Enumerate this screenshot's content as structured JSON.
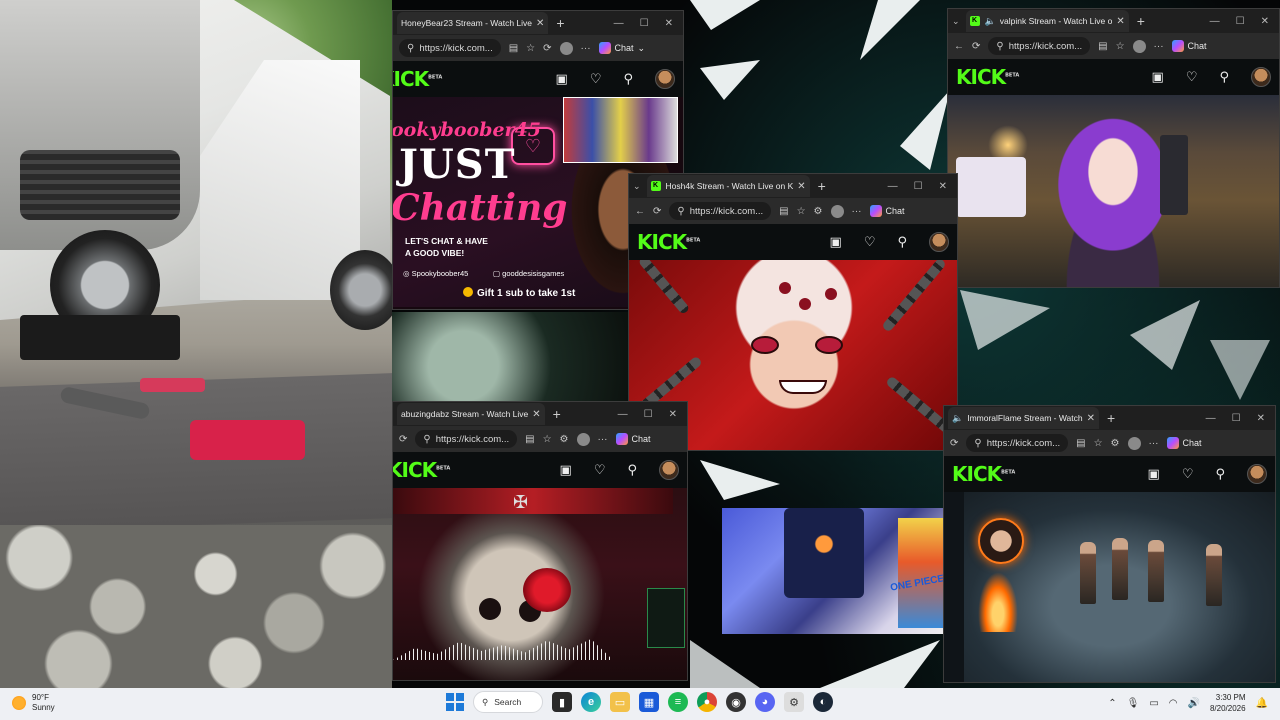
{
  "taskbar": {
    "weather_temp": "90°F",
    "weather_cond": "Sunny",
    "search_label": "Search",
    "time": "3:30 PM",
    "date": "8/20/2026"
  },
  "windows": {
    "honeybear": {
      "tab_title": "HoneyBear23 Stream - Watch Live",
      "url": "https://kick.com...",
      "chat_label": "Chat",
      "overlay": {
        "name": "ookyboober45",
        "just": "JUST",
        "chatting": "Chatting",
        "tagline_1": "LET'S CHAT & HAVE",
        "tagline_2": "A GOOD VIBE!",
        "handle_1": "Spookyboober45",
        "handle_2": "gooddesisisgames",
        "gift": "Gift 1 sub to take 1st"
      }
    },
    "hosh": {
      "tab_title": "Hosh4k Stream - Watch Live on K",
      "url": "https://kick.com...",
      "chat_label": "Chat"
    },
    "valpink": {
      "tab_title": "valpink Stream - Watch Live o",
      "url": "https://kick.com...",
      "chat_label": "Chat"
    },
    "abuzing": {
      "tab_title": "abuzingdabz Stream - Watch Live",
      "url": "https://kick.com...",
      "chat_label": "Chat"
    },
    "immoral": {
      "tab_title": "ImmoralFlame Stream - Watch",
      "url": "https://kick.com...",
      "chat_label": "Chat"
    }
  },
  "kick": {
    "logo": "KICK",
    "beta": "BETA"
  },
  "cam2": {
    "poster_text": "ONE PIECE"
  },
  "colors": {
    "kick_green": "#53fc18",
    "browser_bg": "#202124",
    "taskbar_bg": "#eef0f4"
  }
}
